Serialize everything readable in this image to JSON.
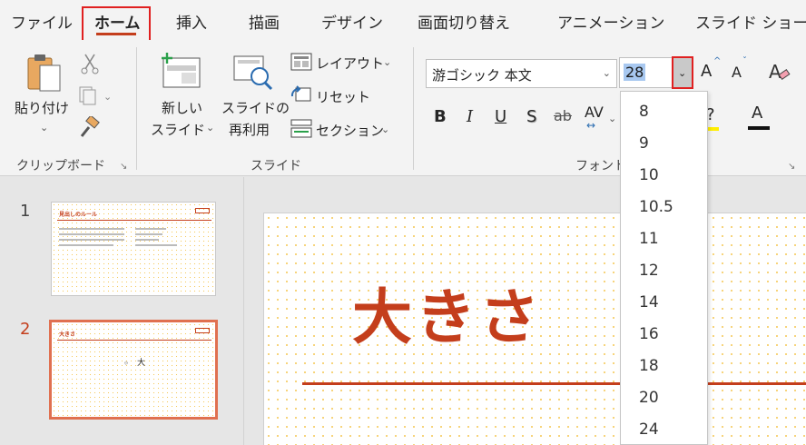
{
  "tabs": [
    "ファイル",
    "ホーム",
    "挿入",
    "描画",
    "デザイン",
    "画面切り替え",
    "アニメーション",
    "スライド ショー"
  ],
  "clipboard": {
    "paste_label": "貼り付け",
    "group_label": "クリップボード"
  },
  "slides_group": {
    "new_slide_line1": "新しい",
    "new_slide_line2": "スライド",
    "reuse_line1": "スライドの",
    "reuse_line2": "再利用",
    "layout_label": "レイアウト",
    "reset_label": "リセット",
    "section_label": "セクション",
    "group_label": "スライド"
  },
  "font_group": {
    "font_name": "游ゴシック 本文",
    "font_size": "28",
    "group_label": "フォント",
    "bold": "B",
    "italic": "I",
    "underline": "U",
    "shadow": "S",
    "strike": "ab",
    "spacing": "AV",
    "grow": "A",
    "shrink": "A",
    "color": "A"
  },
  "font_size_options": [
    "8",
    "9",
    "10",
    "10.5",
    "11",
    "12",
    "14",
    "16",
    "18",
    "20",
    "24"
  ],
  "thumbnails": [
    {
      "number": "1",
      "title": "見出しのルール"
    },
    {
      "number": "2",
      "title": "大きさ",
      "small_text": "小",
      "big_text": "大"
    }
  ],
  "slide": {
    "title": "大きさ"
  },
  "colors": {
    "accent": "#c43e1c",
    "highlight_border": "#e02020",
    "dot": "#f5c95a"
  }
}
